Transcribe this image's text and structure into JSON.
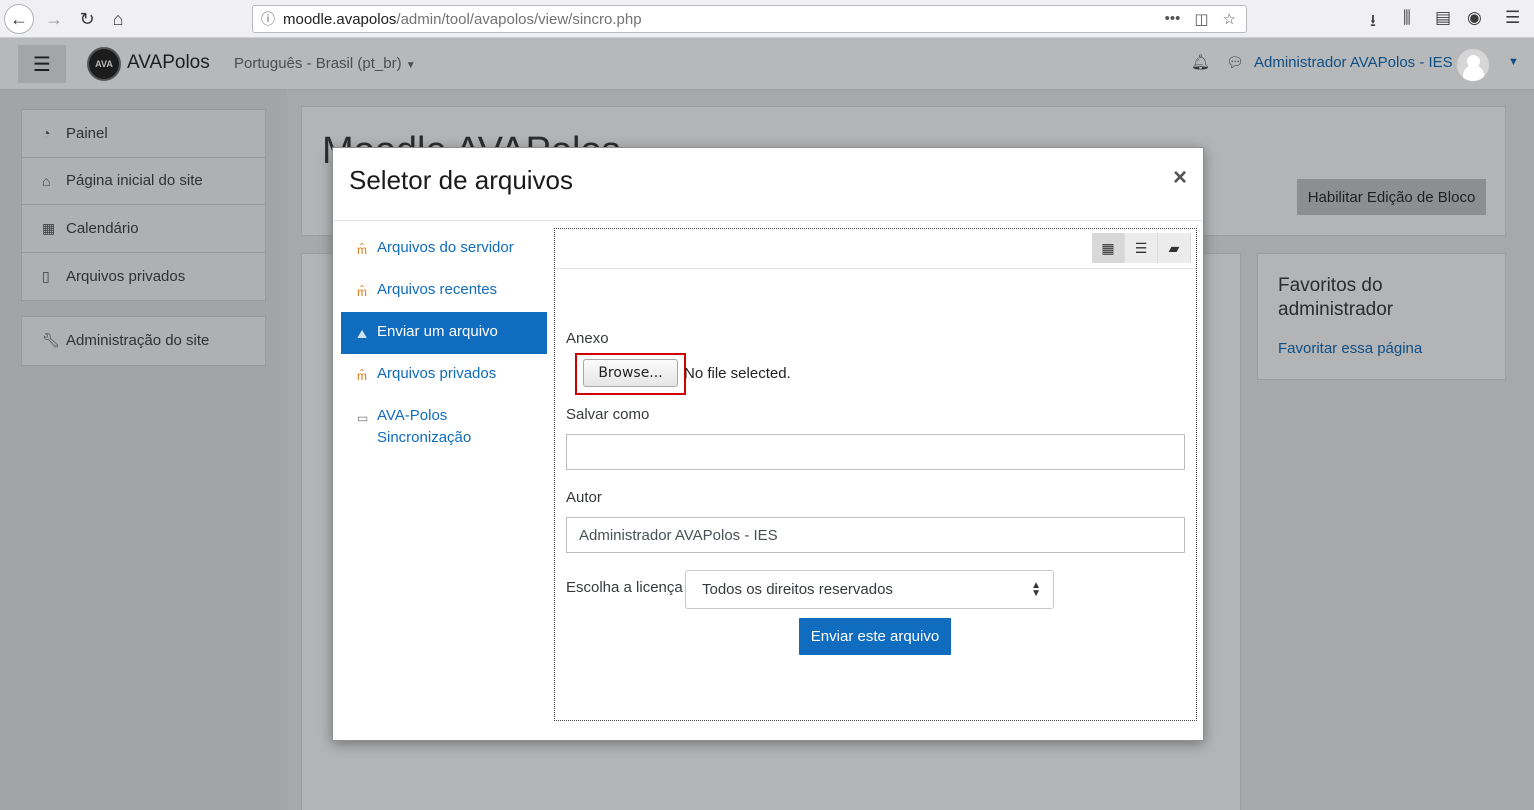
{
  "browser": {
    "url_host": "moodle.avapolos",
    "url_path": "/admin/tool/avapolos/view/sincro.php"
  },
  "navbar": {
    "brand": "AVAPolos",
    "logo_text": "AVA",
    "language": "Português - Brasil (pt_br)",
    "user_name": "Administrador AVAPolos - IES"
  },
  "drawer": {
    "items": [
      "Painel",
      "Página inicial do site",
      "Calendário",
      "Arquivos privados"
    ],
    "admin": "Administração do site"
  },
  "background": {
    "title": "Moodle AVAPolos",
    "edit_button": "Habilitar Edição de Bloco",
    "fav_title": "Favoritos do administrador",
    "fav_link": "Favoritar essa página"
  },
  "modal": {
    "title": "Seletor de arquivos",
    "close": "×",
    "repositories": [
      {
        "label": "Arquivos do servidor",
        "icon": "moodle-icon"
      },
      {
        "label": "Arquivos recentes",
        "icon": "moodle-icon"
      },
      {
        "label": "Enviar um arquivo",
        "icon": "upload-icon",
        "active": true
      },
      {
        "label": "Arquivos privados",
        "icon": "moodle-icon"
      },
      {
        "label": "AVA-Polos Sincronização",
        "icon": "disk-icon"
      }
    ],
    "form": {
      "attachment_label": "Anexo",
      "browse_label": "Browse...",
      "no_file": "No file selected.",
      "save_as_label": "Salvar como",
      "save_as_value": "",
      "author_label": "Autor",
      "author_value": "Administrador AVAPolos - IES",
      "license_label": "Escolha a licença",
      "license_value": "Todos os direitos reservados",
      "submit_label": "Enviar este arquivo"
    }
  }
}
